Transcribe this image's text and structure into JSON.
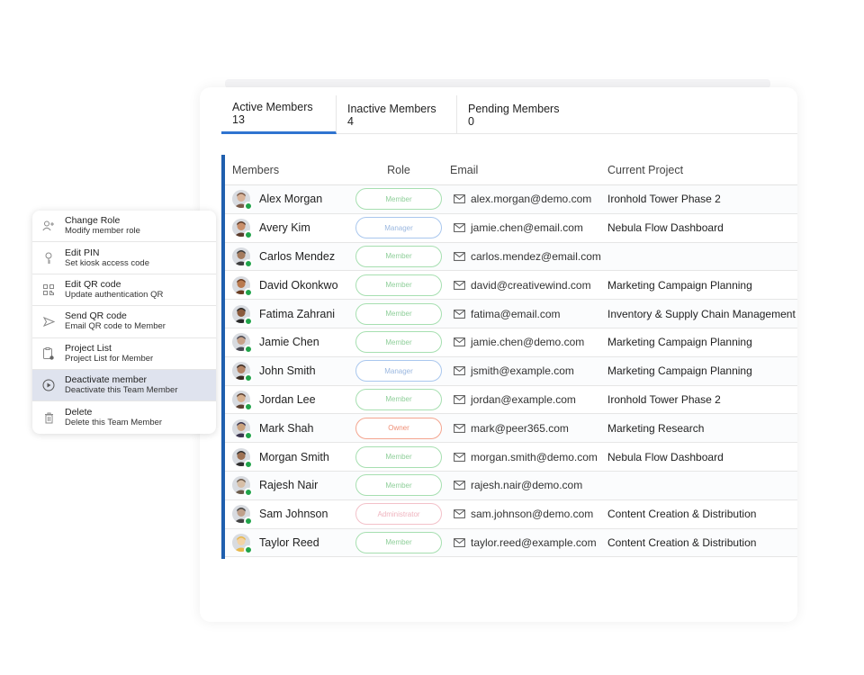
{
  "tabs": [
    {
      "label": "Active Members 13"
    },
    {
      "label": "Inactive Members 4"
    },
    {
      "label": "Pending Members 0"
    }
  ],
  "columns": {
    "members": "Members",
    "role": "Role",
    "email": "Email",
    "project": "Current Project"
  },
  "members": [
    {
      "name": "Alex Morgan",
      "role": "Member",
      "email": "alex.morgan@demo.com",
      "project": "Ironhold Tower Phase 2"
    },
    {
      "name": "Avery Kim",
      "role": "Manager",
      "email": "jamie.chen@email.com",
      "project": "Nebula Flow Dashboard"
    },
    {
      "name": "Carlos Mendez",
      "role": "Member",
      "email": "carlos.mendez@email.com",
      "project": ""
    },
    {
      "name": "David Okonkwo",
      "role": "Member",
      "email": "david@creativewind.com",
      "project": "Marketing Campaign Planning"
    },
    {
      "name": "Fatima Zahrani",
      "role": "Member",
      "email": "fatima@email.com",
      "project": "Inventory & Supply Chain Management"
    },
    {
      "name": "Jamie Chen",
      "role": "Member",
      "email": "jamie.chen@demo.com",
      "project": "Marketing Campaign Planning"
    },
    {
      "name": "John Smith",
      "role": "Manager",
      "email": "jsmith@example.com",
      "project": "Marketing Campaign Planning"
    },
    {
      "name": "Jordan Lee",
      "role": "Member",
      "email": "jordan@example.com",
      "project": "Ironhold Tower Phase 2"
    },
    {
      "name": "Mark Shah",
      "role": "Owner",
      "email": "mark@peer365.com",
      "project": "Marketing Research"
    },
    {
      "name": "Morgan Smith",
      "role": "Member",
      "email": "morgan.smith@demo.com",
      "project": "Nebula Flow Dashboard"
    },
    {
      "name": "Rajesh Nair",
      "role": "Member",
      "email": "rajesh.nair@demo.com",
      "project": ""
    },
    {
      "name": "Sam Johnson",
      "role": "Administrator",
      "email": "sam.johnson@demo.com",
      "project": "Content Creation & Distribution"
    },
    {
      "name": "Taylor Reed",
      "role": "Member",
      "email": "taylor.reed@example.com",
      "project": "Content Creation & Distribution"
    }
  ],
  "menu": [
    {
      "title": "Change Role",
      "sub": "Modify member role",
      "icon": "user-plus-icon"
    },
    {
      "title": "Edit PIN",
      "sub": "Set kiosk access code",
      "icon": "key-icon"
    },
    {
      "title": "Edit QR code",
      "sub": "Update authentication QR",
      "icon": "qr-code-icon"
    },
    {
      "title": "Send QR code",
      "sub": "Email QR code to Member",
      "icon": "send-icon"
    },
    {
      "title": "Project List",
      "sub": "Project List for Member",
      "icon": "clipboard-icon"
    },
    {
      "title": "Deactivate member",
      "sub": "Deactivate this Team Member",
      "icon": "play-circle-icon"
    },
    {
      "title": "Delete",
      "sub": "Delete this Team Member",
      "icon": "trash-icon"
    }
  ],
  "colors": {
    "accent": "#2f74d0",
    "table_bar": "#1f5fae",
    "online": "#21a34a",
    "menu_highlight": "#dfe3ee"
  }
}
